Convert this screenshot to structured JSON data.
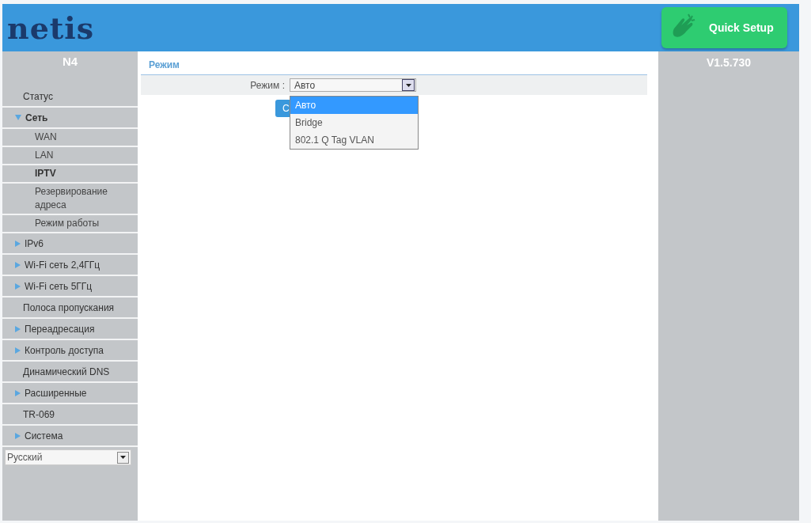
{
  "header": {
    "logo": "netis",
    "quick_setup": "Quick Setup"
  },
  "sidebar": {
    "model": "N4",
    "items": [
      {
        "label": "Статус",
        "kind": "page"
      },
      {
        "label": "Сеть",
        "kind": "folder",
        "expanded": true,
        "children": [
          {
            "label": "WAN",
            "selected": false
          },
          {
            "label": "LAN",
            "selected": false
          },
          {
            "label": "IPTV",
            "selected": true
          },
          {
            "label": "Резервирование адреса",
            "selected": false
          },
          {
            "label": "Режим работы",
            "selected": false
          }
        ]
      },
      {
        "label": "IPv6",
        "kind": "folder",
        "expanded": false
      },
      {
        "label": "Wi-Fi сеть 2,4ГГц",
        "kind": "folder",
        "expanded": false
      },
      {
        "label": "Wi-Fi сеть 5ГГц",
        "kind": "folder",
        "expanded": false
      },
      {
        "label": "Полоса пропускания",
        "kind": "page"
      },
      {
        "label": "Переадресация",
        "kind": "folder",
        "expanded": false
      },
      {
        "label": "Контроль доступа",
        "kind": "folder",
        "expanded": false
      },
      {
        "label": "Динамический DNS",
        "kind": "page"
      },
      {
        "label": "Расширенные",
        "kind": "folder",
        "expanded": false
      },
      {
        "label": "TR-069",
        "kind": "page"
      },
      {
        "label": "Система",
        "kind": "folder",
        "expanded": false
      }
    ],
    "language": "Русский"
  },
  "main": {
    "section_title": "Режим",
    "field_label": "Режим :",
    "field_value": "Авто",
    "button_visible_text": "С",
    "dropdown_options": [
      {
        "label": "Авто",
        "selected": true
      },
      {
        "label": "Bridge",
        "selected": false
      },
      {
        "label": "802.1 Q Tag VLAN",
        "selected": false
      }
    ]
  },
  "version": "V1.5.730"
}
